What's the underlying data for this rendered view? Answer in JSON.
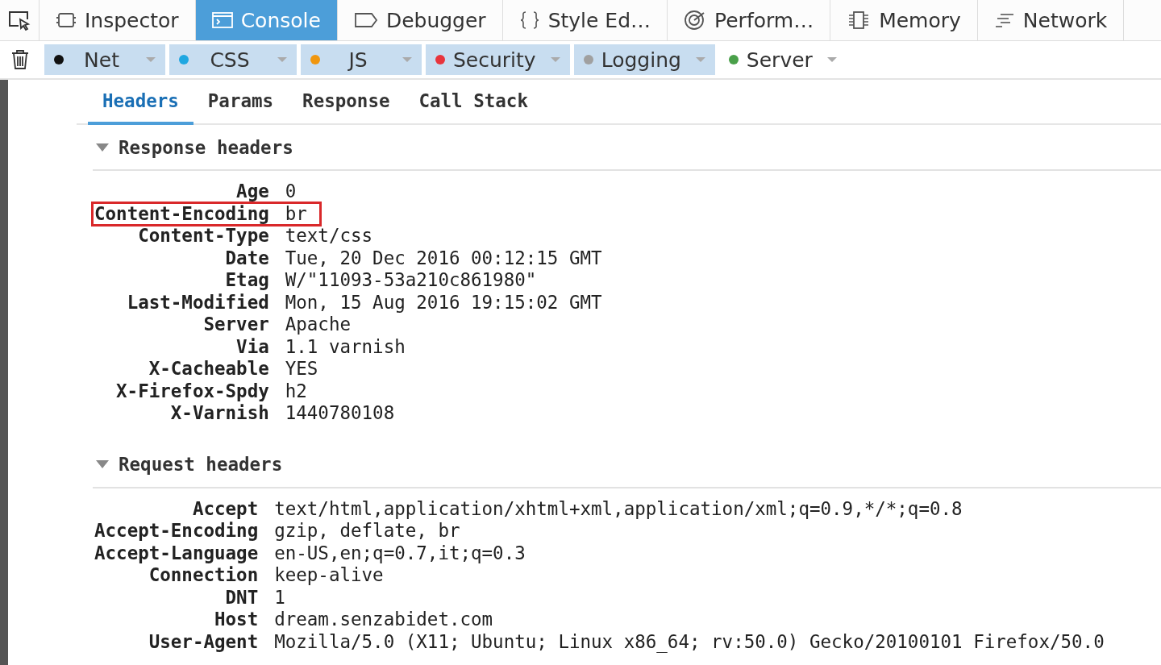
{
  "toolbox_tabs": [
    {
      "label": "Inspector",
      "selected": false
    },
    {
      "label": "Console",
      "selected": true
    },
    {
      "label": "Debugger",
      "selected": false
    },
    {
      "label": "Style Ed…",
      "selected": false
    },
    {
      "label": "Perform…",
      "selected": false
    },
    {
      "label": "Memory",
      "selected": false
    },
    {
      "label": "Network",
      "selected": false
    }
  ],
  "filters": [
    {
      "label": "Net",
      "color": "#111111",
      "selected": true
    },
    {
      "label": "CSS",
      "color": "#1fa7e1",
      "selected": true
    },
    {
      "label": "JS",
      "color": "#f0960e",
      "selected": true
    },
    {
      "label": "Security",
      "color": "#e8343c",
      "selected": true
    },
    {
      "label": "Logging",
      "color": "#a0a0a0",
      "selected": true
    },
    {
      "label": "Server",
      "color": "#4aa04a",
      "selected": false
    }
  ],
  "detail_tabs": [
    {
      "label": "Headers",
      "selected": true
    },
    {
      "label": "Params",
      "selected": false
    },
    {
      "label": "Response",
      "selected": false
    },
    {
      "label": "Call Stack",
      "selected": false
    }
  ],
  "sections": [
    {
      "title": "Response headers",
      "expanded": true,
      "rows": [
        {
          "name": "Age",
          "value": "0",
          "highlighted": false
        },
        {
          "name": "Content-Encoding",
          "value": "br",
          "highlighted": true
        },
        {
          "name": "Content-Type",
          "value": "text/css",
          "highlighted": false
        },
        {
          "name": "Date",
          "value": "Tue, 20 Dec 2016 00:12:15 GMT",
          "highlighted": false
        },
        {
          "name": "Etag",
          "value": "W/\"11093-53a210c861980\"",
          "highlighted": false
        },
        {
          "name": "Last-Modified",
          "value": "Mon, 15 Aug 2016 19:15:02 GMT",
          "highlighted": false
        },
        {
          "name": "Server",
          "value": "Apache",
          "highlighted": false
        },
        {
          "name": "Via",
          "value": "1.1 varnish",
          "highlighted": false
        },
        {
          "name": "X-Cacheable",
          "value": "YES",
          "highlighted": false
        },
        {
          "name": "X-Firefox-Spdy",
          "value": "h2",
          "highlighted": false
        },
        {
          "name": "X-Varnish",
          "value": "1440780108",
          "highlighted": false
        }
      ]
    },
    {
      "title": "Request headers",
      "expanded": true,
      "rows": [
        {
          "name": "Accept",
          "value": "text/html,application/xhtml+xml,application/xml;q=0.9,*/*;q=0.8",
          "highlighted": false
        },
        {
          "name": "Accept-Encoding",
          "value": "gzip, deflate, br",
          "highlighted": false
        },
        {
          "name": "Accept-Language",
          "value": "en-US,en;q=0.7,it;q=0.3",
          "highlighted": false
        },
        {
          "name": "Connection",
          "value": "keep-alive",
          "highlighted": false
        },
        {
          "name": "DNT",
          "value": "1",
          "highlighted": false
        },
        {
          "name": "Host",
          "value": "dream.senzabidet.com",
          "highlighted": false
        },
        {
          "name": "User-Agent",
          "value": "Mozilla/5.0 (X11; Ubuntu; Linux x86_64; rv:50.0) Gecko/20100101 Firefox/50.0",
          "highlighted": false
        }
      ]
    }
  ]
}
